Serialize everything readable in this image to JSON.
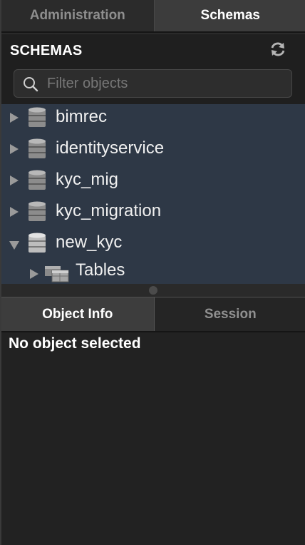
{
  "top_tabs": {
    "administration": "Administration",
    "schemas": "Schemas"
  },
  "header": {
    "title": "SCHEMAS",
    "refresh_icon": "refresh-icon"
  },
  "search": {
    "placeholder": "Filter objects",
    "icon": "search-icon"
  },
  "tree": {
    "schemas": [
      {
        "label": "bimrec",
        "expanded": false
      },
      {
        "label": "identityservice",
        "expanded": false
      },
      {
        "label": "kyc_mig",
        "expanded": false
      },
      {
        "label": "kyc_migration",
        "expanded": false
      },
      {
        "label": "new_kyc",
        "expanded": true
      }
    ],
    "children": {
      "tables": "Tables"
    }
  },
  "bottom_tabs": {
    "object_info": "Object Info",
    "session": "Session"
  },
  "info": {
    "text": "No object selected"
  },
  "colors": {
    "tree_selection": "#2e3846",
    "panel_bg": "#1f1f1f"
  }
}
